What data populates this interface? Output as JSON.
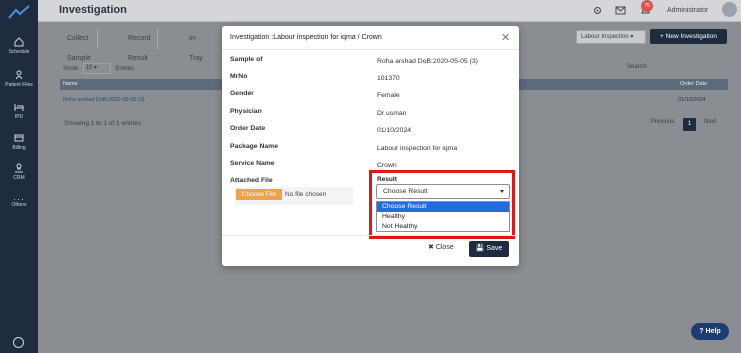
{
  "sidebar": {
    "items": [
      {
        "label": "Schedule",
        "icon": "home-icon"
      },
      {
        "label": "Patient Files",
        "icon": "person-icon"
      },
      {
        "label": "IPD",
        "icon": "bed-icon"
      },
      {
        "label": "Billing",
        "icon": "billing-icon"
      },
      {
        "label": "CRM",
        "icon": "crm-icon"
      },
      {
        "label": "Others",
        "icon": "more-icon"
      }
    ]
  },
  "header": {
    "title": "Investigation",
    "notification_count": "76",
    "user_name": "Administrator"
  },
  "page": {
    "tabs": [
      "Collect Sample",
      "Record Result",
      "In-Tray"
    ],
    "package_filter": "Labour Inspection",
    "new_button": "+ New Investigation",
    "show_label": "Show",
    "show_value": "10",
    "entries_label": "Entries",
    "search_label": "Search:",
    "columns": {
      "name": "Name",
      "order_date": "Order Date"
    },
    "row": {
      "name": "Roha arshad DoB:2020-05-05 (3)",
      "order_date": "01/10/2024"
    },
    "showing": "Showing 1 to 1 of 1 entries",
    "pager": {
      "previous": "Previous",
      "current": "1",
      "next": "Next"
    },
    "help": "Help"
  },
  "modal": {
    "title": "Investigation :Labour inspection for iqma / Crown",
    "fields": [
      {
        "label": "Sample of",
        "value": "Roha arshad DoB:2020-05-05 (3)"
      },
      {
        "label": "MrNo",
        "value": "101370"
      },
      {
        "label": "Gender",
        "value": "Female"
      },
      {
        "label": "Physician",
        "value": "Dr usman"
      },
      {
        "label": "Order Date",
        "value": "01/10/2024"
      },
      {
        "label": "Package Name",
        "value": "Labour inspection for iqma"
      },
      {
        "label": "Service Name",
        "value": "Crown"
      }
    ],
    "attached_file_label": "Attached File",
    "choose_file": "Choose File",
    "no_file": "No file chosen",
    "result_label": "Result",
    "result_selected": "Choose Result",
    "result_options": [
      "Choose Result",
      "Healthy",
      "Not Healthy"
    ],
    "close_label": "Close",
    "save_label": "Save"
  },
  "colors": {
    "sidebar": "#1f2c3f",
    "highlight_box": "#e0161b",
    "file_button": "#f0a24a",
    "selected_option": "#1e6fd9"
  }
}
